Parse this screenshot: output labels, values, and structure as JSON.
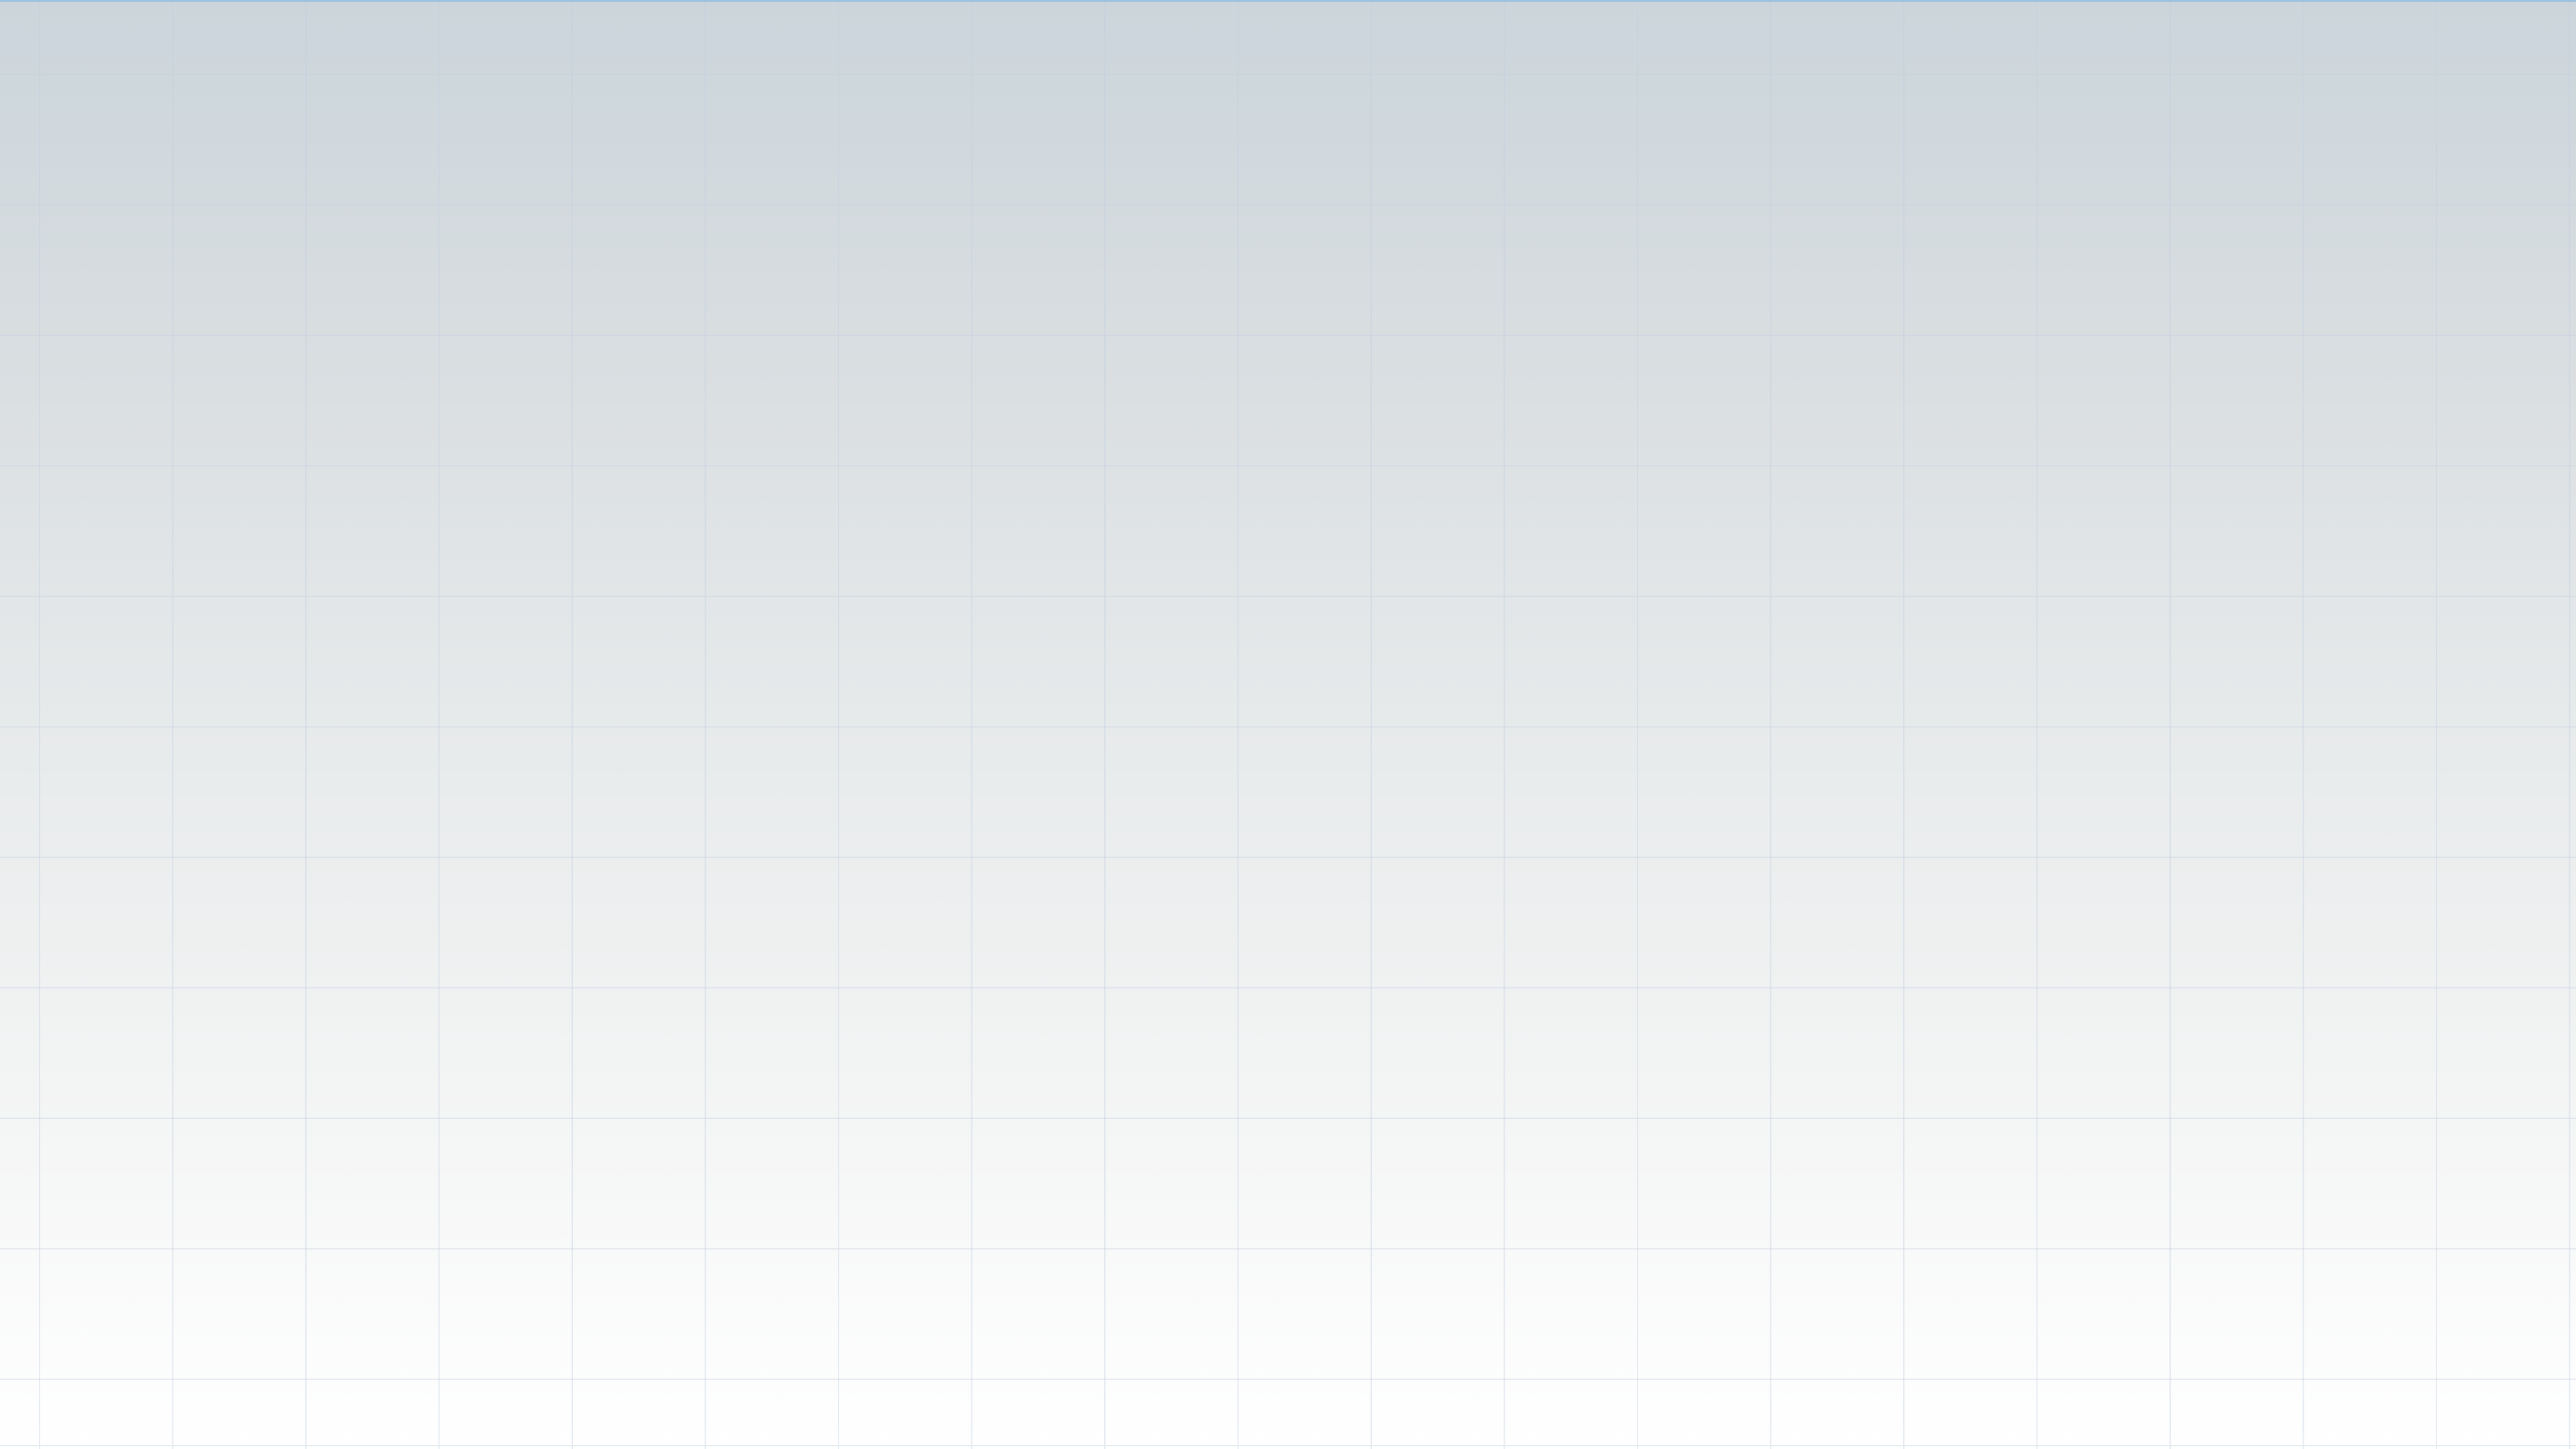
{
  "canvas": {
    "background": "gradient",
    "gradient_colors": [
      "#cbd5db",
      "#ffffff"
    ],
    "grid": true,
    "grid_color": "#c0cdde",
    "accent_top_rule": "#9fc3de"
  }
}
